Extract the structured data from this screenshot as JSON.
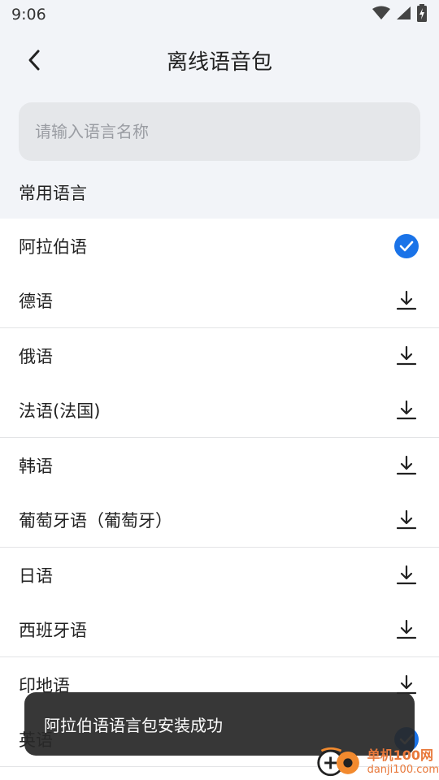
{
  "status_bar": {
    "time": "9:06"
  },
  "header": {
    "title": "离线语音包"
  },
  "search": {
    "placeholder": "请输入语言名称",
    "value": ""
  },
  "section": {
    "title": "常用语言"
  },
  "languages": [
    {
      "label": "阿拉伯语",
      "status": "installed"
    },
    {
      "label": "德语",
      "status": "download"
    },
    {
      "label": "俄语",
      "status": "download"
    },
    {
      "label": "法语(法国)",
      "status": "download"
    },
    {
      "label": "韩语",
      "status": "download"
    },
    {
      "label": "葡萄牙语（葡萄牙）",
      "status": "download"
    },
    {
      "label": "日语",
      "status": "download"
    },
    {
      "label": "西班牙语",
      "status": "download"
    },
    {
      "label": "印地语",
      "status": "download"
    },
    {
      "label": "英语",
      "status": "installed"
    }
  ],
  "toast": {
    "message": "阿拉伯语语言包安装成功"
  },
  "watermark": {
    "main": "单机100网",
    "sub": "danji100.com"
  },
  "colors": {
    "accent": "#1a73e8",
    "background": "#f2f4f8",
    "toast": "#282828"
  }
}
